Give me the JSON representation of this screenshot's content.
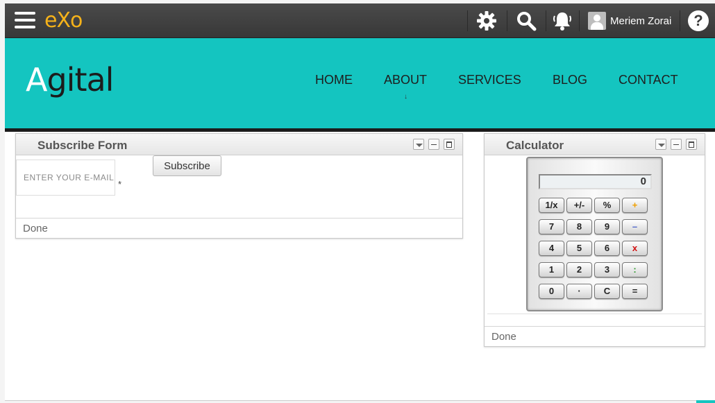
{
  "toolbar": {
    "logo": "eXo",
    "user_name": "Meriem Zorai",
    "help_label": "?",
    "icons": [
      "menu-icon",
      "settings-gear-icon",
      "search-icon",
      "notifications-bell-icon",
      "user-avatar-icon",
      "help-icon"
    ]
  },
  "brand": {
    "logo_first": "A",
    "logo_rest": "gital",
    "nav": [
      "HOME",
      "ABOUT",
      "SERVICES",
      "BLOG",
      "CONTACT"
    ],
    "nav_about_marker": "↓",
    "colors": {
      "header_bg": "#14c5c0",
      "toolbar_bg": "#3c3c3c",
      "logo_accent": "#f5b21a"
    }
  },
  "subscribe": {
    "title": "Subscribe Form",
    "email_placeholder": "ENTER YOUR E-MAIL",
    "required_mark": "*",
    "button_label": "Subscribe",
    "status": "Done"
  },
  "calculator": {
    "title": "Calculator",
    "display": "0",
    "keys": [
      [
        "1/x",
        "+/-",
        "%",
        "+"
      ],
      [
        "7",
        "8",
        "9",
        "–"
      ],
      [
        "4",
        "5",
        "6",
        "x"
      ],
      [
        "1",
        "2",
        "3",
        ":"
      ],
      [
        "0",
        "·",
        "C",
        "="
      ]
    ],
    "status": "Done"
  }
}
